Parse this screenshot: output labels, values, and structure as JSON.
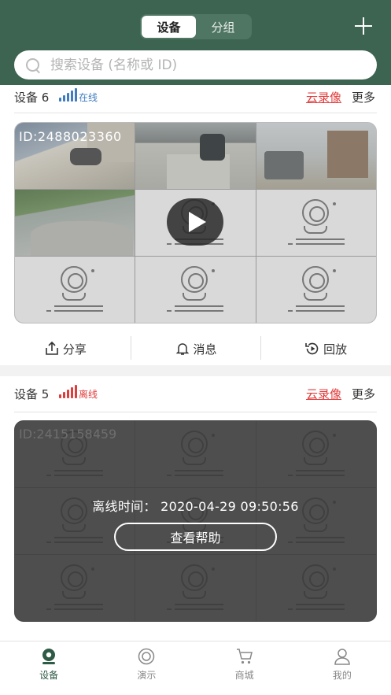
{
  "header": {
    "tabs": [
      {
        "label": "设备"
      },
      {
        "label": "分组"
      }
    ]
  },
  "search": {
    "placeholder": "搜索设备 (名称或 ID)"
  },
  "devices": [
    {
      "name": "设备 6",
      "status": "在线",
      "status_color": "#3f7cc0",
      "cloud_label": "云录像",
      "more_label": "更多",
      "id_label": "ID:2488023360",
      "actions": [
        {
          "label": "分享"
        },
        {
          "label": "消息"
        },
        {
          "label": "回放"
        }
      ]
    },
    {
      "name": "设备 5",
      "status": "离线",
      "status_color": "#e13c3c",
      "cloud_label": "云录像",
      "more_label": "更多",
      "id_label": "ID:2415158459",
      "offline_time": "离线时间：  2020-04-29 09:50:56",
      "help_label": "查看帮助"
    }
  ],
  "tabbar": {
    "items": [
      {
        "label": "设备",
        "icon": "device-icon"
      },
      {
        "label": "演示",
        "icon": "demo-icon"
      },
      {
        "label": "商城",
        "icon": "cart-icon"
      },
      {
        "label": "我的",
        "icon": "profile-icon"
      }
    ]
  },
  "colors": {
    "header": "#3d6450",
    "accent_red": "#e13c3c",
    "online_blue": "#3f7cc0",
    "active_tab": "#2f5a46"
  }
}
